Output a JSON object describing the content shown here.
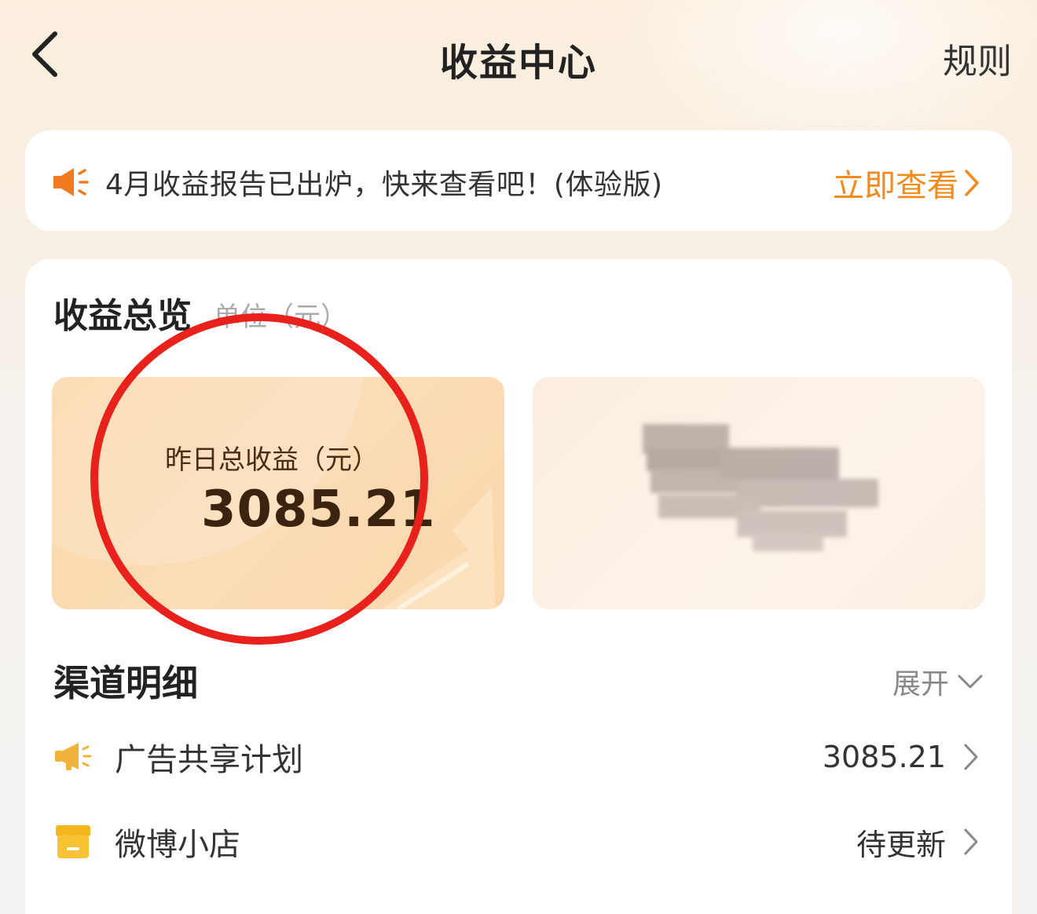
{
  "header": {
    "title": "收益中心",
    "rules_label": "规则",
    "back_icon": "chevron-left-icon"
  },
  "notice": {
    "icon": "speaker-icon",
    "text": "4月收益报告已出炉，快来查看吧！(体验版)",
    "action_label": "立即查看"
  },
  "overview": {
    "title": "收益总览",
    "unit": "单位（元）",
    "yesterday_label": "昨日总收益（元）",
    "yesterday_value": "3085.21"
  },
  "channels": {
    "title": "渠道明细",
    "expand_label": "展开",
    "items": [
      {
        "label": "广告共享计划",
        "value": "3085.21",
        "icon": "megaphone-icon"
      },
      {
        "label": "微博小店",
        "value": "待更新",
        "icon": "shop-icon"
      }
    ]
  },
  "colors": {
    "accent": "#f28a1e",
    "earn_card": "#fbd7a8",
    "annotation_circle": "#e8211c"
  }
}
